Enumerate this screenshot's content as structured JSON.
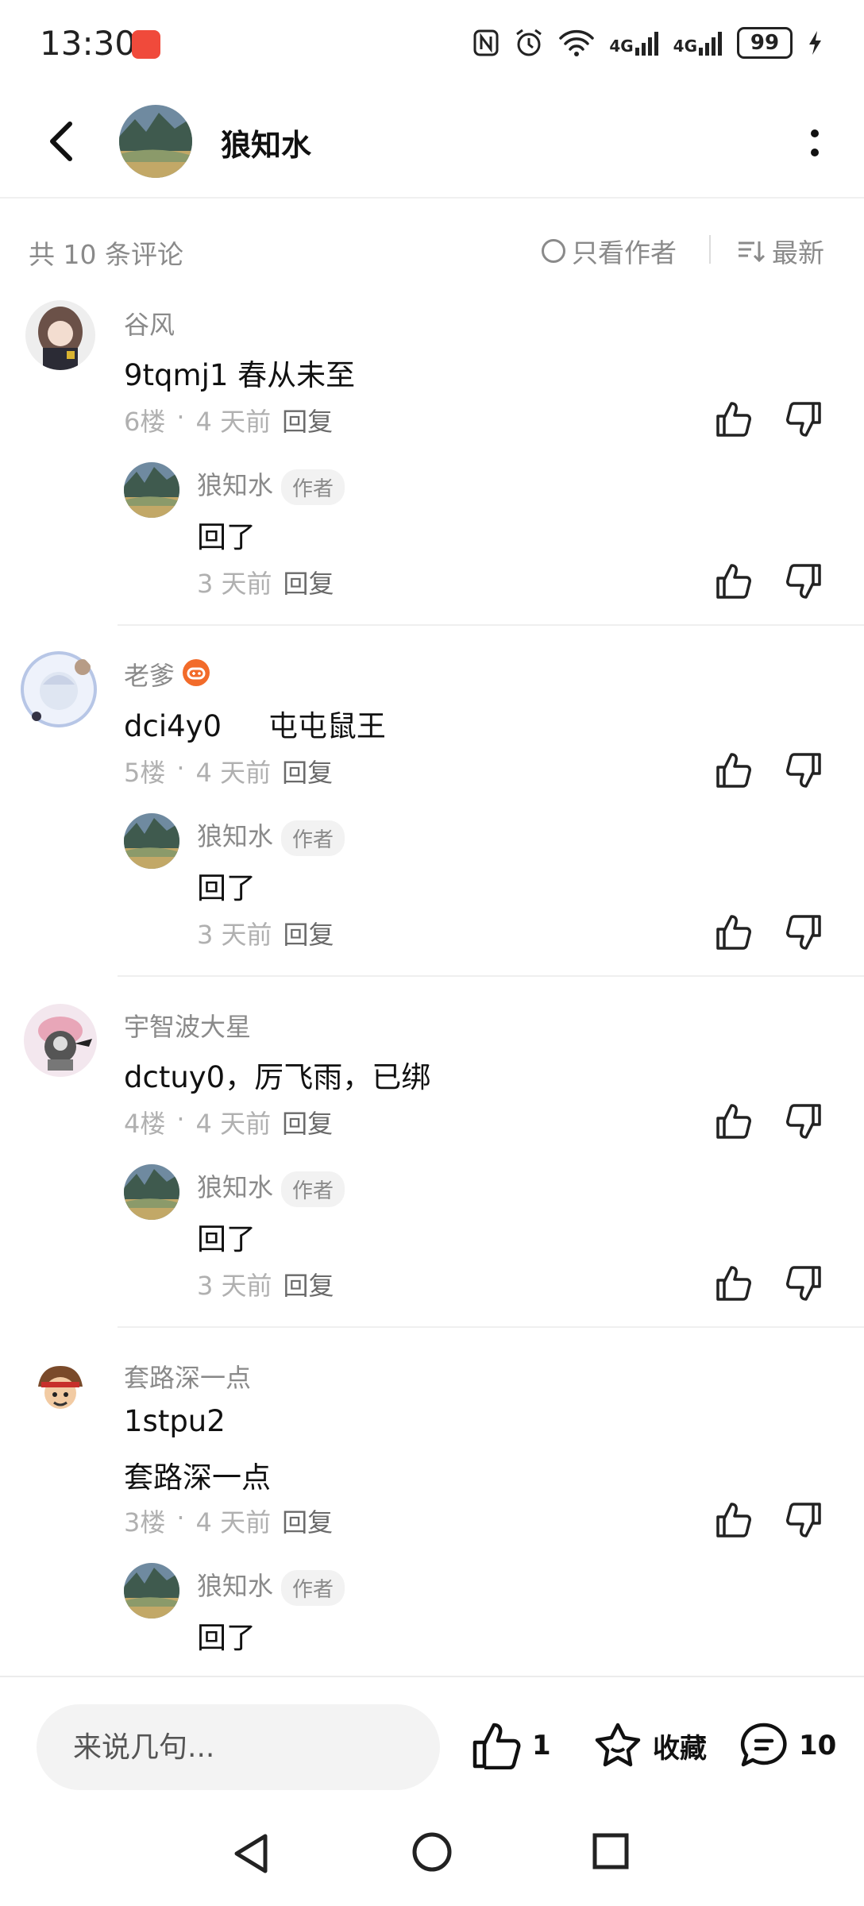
{
  "status_bar": {
    "time": "13:30",
    "battery": "99",
    "network1": "4G",
    "network2": "4G"
  },
  "header": {
    "title": "狼知水"
  },
  "filter": {
    "count": "共 10 条评论",
    "author_only": "只看作者",
    "sort": "最新"
  },
  "comments": [
    {
      "user": "谷风",
      "text": "9tqmj1 春从未至",
      "floor": "6楼",
      "time": "4 天前",
      "reply": "回复",
      "sub": {
        "user": "狼知水",
        "tag": "作者",
        "text": "回了",
        "time": "3 天前",
        "reply": "回复"
      }
    },
    {
      "user": "老爹",
      "text": "dci4y0     屯屯鼠王",
      "floor": "5楼",
      "time": "4 天前",
      "reply": "回复",
      "sub": {
        "user": "狼知水",
        "tag": "作者",
        "text": "回了",
        "time": "3 天前",
        "reply": "回复"
      }
    },
    {
      "user": "宇智波大星",
      "text": "dctuy0，厉飞雨，已绑",
      "floor": "4楼",
      "time": "4 天前",
      "reply": "回复",
      "sub": {
        "user": "狼知水",
        "tag": "作者",
        "text": "回了",
        "time": "3 天前",
        "reply": "回复"
      }
    },
    {
      "user": "套路深一点",
      "text": "1stpu2",
      "text2": "套路深一点",
      "floor": "3楼",
      "time": "4 天前",
      "reply": "回复",
      "sub": {
        "user": "狼知水",
        "tag": "作者",
        "text": "回了"
      }
    }
  ],
  "bottom_bar": {
    "placeholder": "来说几句...",
    "likes": "1",
    "favorite": "收藏",
    "comments": "10"
  },
  "colors": {
    "accent_orange": "#f26b2a",
    "text_gray": "#8a8a8a",
    "call_red": "#f04a3b"
  }
}
